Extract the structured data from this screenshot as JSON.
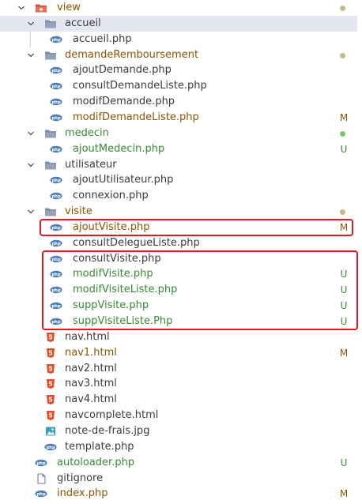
{
  "colors": {
    "modified": "#895503",
    "untracked": "#388a34",
    "highlight_box": "#e01a22",
    "php_icon": "#4f7fb6",
    "html_icon": "#e44d26"
  },
  "tree": {
    "rows": [
      {
        "label": "view",
        "kind": "folder-red",
        "status": "dot-mod",
        "chevron": true
      },
      {
        "label": "accueil",
        "kind": "folder",
        "status": "",
        "chevron": true,
        "selected": true
      },
      {
        "label": "accueil.php",
        "kind": "php",
        "status": ""
      },
      {
        "label": "demandeRemboursement",
        "kind": "folder",
        "status": "dot-mod",
        "chevron": true
      },
      {
        "label": "ajoutDemande.php",
        "kind": "php",
        "status": ""
      },
      {
        "label": "consultDemandeListe.php",
        "kind": "php",
        "status": ""
      },
      {
        "label": "modifDemande.php",
        "kind": "php",
        "status": ""
      },
      {
        "label": "modifDemandeListe.php",
        "kind": "php",
        "status": "M"
      },
      {
        "label": "medecin",
        "kind": "folder",
        "status": "dot-unt",
        "chevron": true
      },
      {
        "label": "ajoutMedecin.php",
        "kind": "php",
        "status": "U"
      },
      {
        "label": "utilisateur",
        "kind": "folder",
        "status": "",
        "chevron": true
      },
      {
        "label": "ajoutUtilisateur.php",
        "kind": "php",
        "status": ""
      },
      {
        "label": "connexion.php",
        "kind": "php",
        "status": ""
      },
      {
        "label": "visite",
        "kind": "folder",
        "status": "dot-mod",
        "chevron": true
      },
      {
        "label": "ajoutVisite.php",
        "kind": "php",
        "status": "M"
      },
      {
        "label": "consultDelegueListe.php",
        "kind": "php",
        "status": ""
      },
      {
        "label": "consultVisite.php",
        "kind": "php",
        "status": ""
      },
      {
        "label": "modifVisite.php",
        "kind": "php",
        "status": "U"
      },
      {
        "label": "modifVisiteListe.php",
        "kind": "php",
        "status": "U"
      },
      {
        "label": "suppVisite.php",
        "kind": "php",
        "status": "U"
      },
      {
        "label": "suppVisiteListe.Php",
        "kind": "php",
        "status": "U"
      },
      {
        "label": "nav.html",
        "kind": "html",
        "status": ""
      },
      {
        "label": "nav1.html",
        "kind": "html",
        "status": "M"
      },
      {
        "label": "nav2.html",
        "kind": "html",
        "status": ""
      },
      {
        "label": "nav3.html",
        "kind": "html",
        "status": ""
      },
      {
        "label": "nav4.html",
        "kind": "html",
        "status": ""
      },
      {
        "label": "navcomplete.html",
        "kind": "html",
        "status": ""
      },
      {
        "label": "note-de-frais.jpg",
        "kind": "image",
        "status": ""
      },
      {
        "label": "template.php",
        "kind": "php",
        "status": ""
      },
      {
        "label": "autoloader.php",
        "kind": "php",
        "status": "U"
      },
      {
        "label": "gitignore",
        "kind": "file",
        "status": ""
      },
      {
        "label": "index.php",
        "kind": "php",
        "status": "M"
      }
    ]
  }
}
